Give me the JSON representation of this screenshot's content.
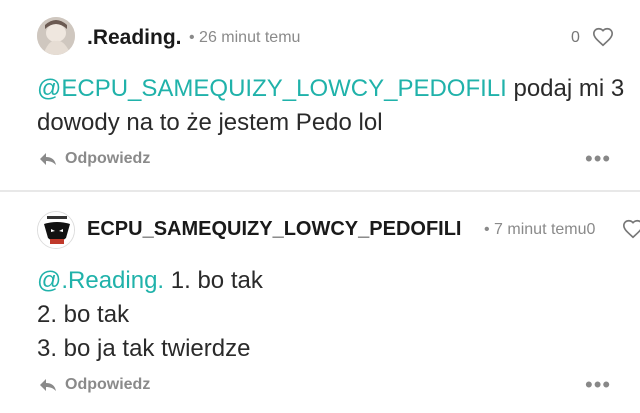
{
  "comments": [
    {
      "username": ".Reading.",
      "meta": "• 26 minut temu",
      "likes": "0",
      "mention": "@ECPU_SAMEQUIZY_LOWCY_PEDOFILI",
      "text": " podaj mi 3 dowody na to że jestem Pedo lol",
      "reply_label": "Odpowiedz",
      "more_label": "•••"
    },
    {
      "username": "ECPU_SAMEQUIZY_LOWCY_PEDOFILI",
      "meta": "• 7 minut temu0",
      "mention": "@.Reading.",
      "line1": " 1. bo tak",
      "line2": "2. bo tak",
      "line3": "3. bo ja tak twierdze",
      "reply_label": "Odpowiedz",
      "more_label": "•••"
    }
  ],
  "colors": {
    "mention": "#20b2aa",
    "meta": "#8a8a8a",
    "divider": "#e8e8e8"
  },
  "icons": [
    "heart-outline-icon",
    "reply-arrow-icon",
    "more-dots-icon"
  ]
}
